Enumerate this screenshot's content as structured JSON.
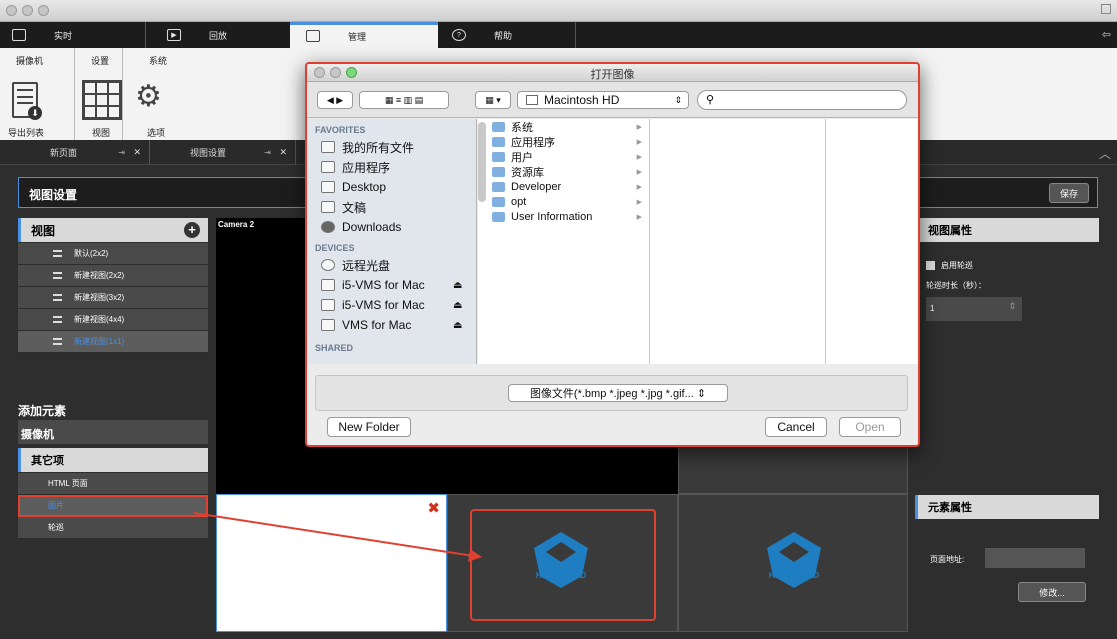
{
  "menubar": {
    "items": [
      {
        "label": "实时",
        "icon": "monitor-icon"
      },
      {
        "label": "回放",
        "icon": "play-icon"
      },
      {
        "label": "管理",
        "icon": "folder-icon"
      },
      {
        "label": "帮助",
        "icon": "help-icon"
      }
    ]
  },
  "ribbon": {
    "groups": [
      "摄像机",
      "设置",
      "系统"
    ],
    "buttons": [
      "导出列表",
      "视图",
      "选项"
    ]
  },
  "tabs": [
    {
      "label": "新页面",
      "close": "✕"
    },
    {
      "label": "视图设置",
      "close": "✕"
    }
  ],
  "viewsettings": {
    "title": "视图设置",
    "save_label": "保存"
  },
  "views_panel": {
    "title": "视图",
    "items": [
      "默认(2x2)",
      "新建视图(2x2)",
      "新建视图(3x2)",
      "新建视图(4x4)",
      "新建视图(1x1)"
    ]
  },
  "add_element": {
    "title": "添加元素",
    "camera_label": "摄像机",
    "other_label": "其它项",
    "items": [
      "HTML 页面",
      "图片",
      "轮巡"
    ]
  },
  "grid": {
    "camera_label": "Camera 2",
    "logo_text": "HEROSPEED"
  },
  "view_props": {
    "title": "视图属性",
    "patrol_label": "启用轮巡",
    "duration_label": "轮巡时长（秒）：",
    "duration_value": "1"
  },
  "element_props": {
    "title": "元素属性",
    "url_label": "页面地址:",
    "modify_label": "修改..."
  },
  "dialog": {
    "title": "打开图像",
    "location": "Macintosh HD",
    "favorites_label": "FAVORITES",
    "favorites": [
      "我的所有文件",
      "应用程序",
      "Desktop",
      "文稿",
      "Downloads"
    ],
    "devices_label": "DEVICES",
    "devices": [
      "远程光盘",
      "i5-VMS for Mac",
      "i5-VMS for Mac",
      "VMS for Mac"
    ],
    "shared_label": "SHARED",
    "files": [
      "系统",
      "应用程序",
      "用户",
      "资源库",
      "Developer",
      "opt",
      "User Information"
    ],
    "filter": "图像文件(*.bmp *.jpeg *.jpg *.gif... ⇕",
    "new_folder": "New Folder",
    "cancel": "Cancel",
    "open": "Open"
  },
  "colors": {
    "accent": "#4a90e2",
    "highlight": "#e04030",
    "logo": "#1f7ec2"
  }
}
